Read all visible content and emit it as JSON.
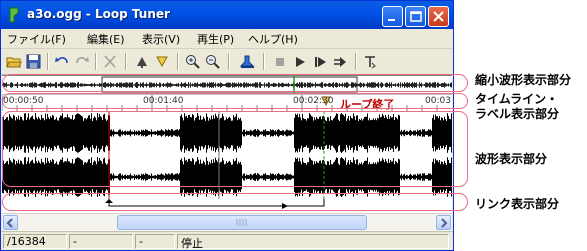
{
  "window": {
    "title": "a3o.ogg - Loop Tuner",
    "colors": {
      "titlebar": "#0050e6",
      "face": "#ece9d8",
      "wave": "#000000",
      "loop_marker": "#c00000",
      "annotation": "#ea6f82"
    }
  },
  "menu": [
    {
      "label": "ファイル(F)"
    },
    {
      "label": "編集(E)"
    },
    {
      "label": "表示(V)"
    },
    {
      "label": "再生(P)"
    },
    {
      "label": "ヘルプ(H)"
    }
  ],
  "toolbar": {
    "icons": [
      "open-icon",
      "save-icon",
      "undo-icon",
      "redo-icon",
      "cut-icon",
      "set-loop-start-icon",
      "set-loop-end-icon",
      "zoom-in-icon",
      "zoom-out-icon",
      "bookmark-icon",
      "stop-icon",
      "play-icon",
      "play-from-cursor-icon",
      "play-loop-icon",
      "export-icon"
    ]
  },
  "timeline": {
    "ticks": [
      "00:00:50",
      "00:01:40",
      "00:02:30",
      "00:03"
    ],
    "loop_end_label": "ループ終了"
  },
  "status": {
    "position": "/16384",
    "field2": "-",
    "field3": "-",
    "state": "停止"
  },
  "annotations": [
    {
      "label": "縮小波形表示部分"
    },
    {
      "label": "タイムライン・"
    },
    {
      "label": "ラベル表示部分"
    },
    {
      "label": "波形表示部分"
    },
    {
      "label": "リンク表示部分"
    }
  ]
}
